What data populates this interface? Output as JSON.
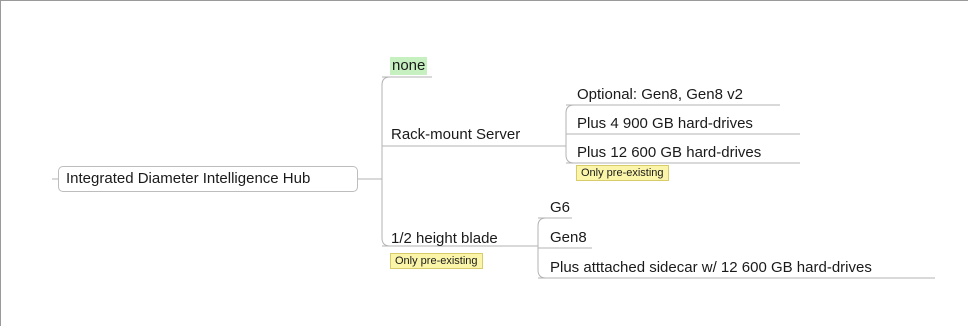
{
  "mindmap": {
    "root": "Integrated Diameter Intelligence Hub",
    "branches": [
      {
        "label": "none",
        "highlight": "#c7f0c0"
      },
      {
        "label": "Rack-mount Server",
        "children": [
          {
            "label": "Optional: Gen8, Gen8 v2"
          },
          {
            "label": "Plus 4 900 GB hard-drives"
          },
          {
            "label": "Plus 12 600 GB hard-drives",
            "note": "Only pre-existing"
          }
        ]
      },
      {
        "label": "1/2 height blade",
        "note": "Only pre-existing",
        "children": [
          {
            "label": "G6"
          },
          {
            "label": "Gen8"
          },
          {
            "label": "Plus atttached sidecar w/ 12 600 GB hard-drives"
          }
        ]
      }
    ]
  },
  "colors": {
    "note_fill": "#fbf5a9",
    "connector": "#b3b3b3",
    "none_highlight": "#c7f0c0"
  }
}
